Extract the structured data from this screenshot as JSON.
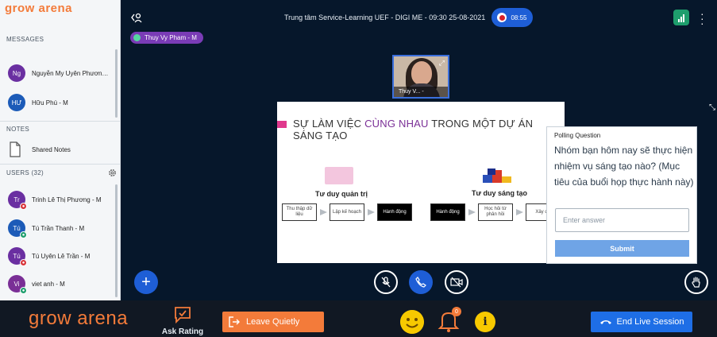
{
  "sidebar": {
    "brand": "grow arena",
    "messages_title": "MESSAGES",
    "messages": [
      {
        "initials": "Ng",
        "name": "Nguyễn My Uyên Phương ...",
        "color": "#6a2fa1"
      },
      {
        "initials": "HƯ",
        "name": "Hữu Phú - M",
        "color": "#1c5bb8"
      }
    ],
    "notes_title": "NOTES",
    "shared_notes": "Shared Notes",
    "users_title": "USERS (32)",
    "users": [
      {
        "initials": "Tr",
        "name": "Trinh Lê Thị Phương - M",
        "color": "#6a2fa1",
        "status_color": "#d8343a"
      },
      {
        "initials": "Tú",
        "name": "Tú Trần Thanh - M",
        "color": "#1c5bb8",
        "status_color": "#1e9e6d"
      },
      {
        "initials": "Tú",
        "name": "Tú Uyên Lê Trần - M",
        "color": "#6a2fa1",
        "status_color": "#d8343a"
      },
      {
        "initials": "Vi",
        "name": "viet anh - M",
        "color": "#7a2f96",
        "status_color": "#1e9e6d"
      }
    ]
  },
  "header": {
    "title": "Trung tâm Service-Learning UEF - DIGI ME - 09:30 25-08-2021",
    "timer": "08:55"
  },
  "presenter": {
    "name": "Thuy Vy Pham - M"
  },
  "webcam": {
    "name": "Thuy V... -"
  },
  "slide": {
    "title_part1": "SỰ LÀM VIỆC ",
    "title_highlight": "CÙNG NHAU",
    "title_part2": " TRONG MỘT DỰ ÁN SÁNG TẠO",
    "flow1": {
      "title": "Tư duy quản trị",
      "steps": [
        "Thu thập dữ liệu",
        "Lập kế hoạch",
        "Hành động"
      ]
    },
    "flow2": {
      "title": "Tư duy sáng tạo",
      "steps": [
        "Hành động",
        "Học hỏi từ phản hồi",
        "Xây d"
      ]
    }
  },
  "poll": {
    "heading": "Polling Question",
    "question": "Nhóm bạn hôm nay sẽ thực hiện nhiệm vụ sáng tạo nào? (Mục tiêu của buổi họp thực hành này)",
    "placeholder": "Enter answer",
    "submit_label": "Submit"
  },
  "bottombar": {
    "brand": "grow arena",
    "ask_rating": "Ask Rating",
    "leave": "Leave Quietly",
    "notifications_count": "0",
    "info": "i",
    "end": "End Live Session"
  },
  "colors": {
    "accent": "#1e5ed6",
    "brand_orange": "#f37b3a",
    "background": "#06172b"
  }
}
